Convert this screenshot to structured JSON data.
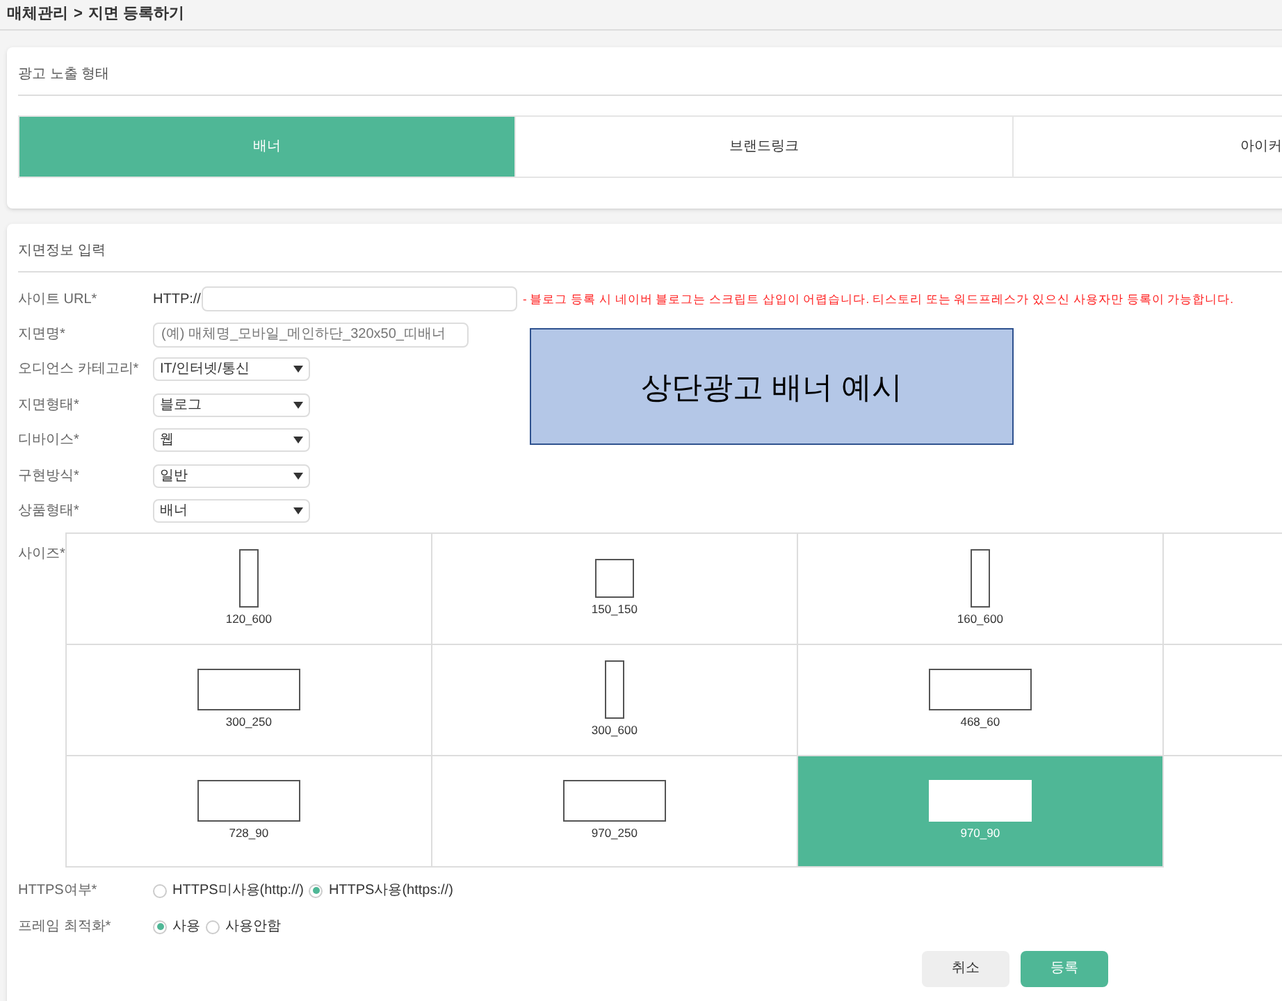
{
  "breadcrumb": {
    "parent": "매체관리",
    "separator": ">",
    "current": "지면 등록하기"
  },
  "ad_type": {
    "title": "광고 노출 형태",
    "tabs": [
      {
        "label": "배너",
        "selected": true
      },
      {
        "label": "브랜드링크",
        "selected": false
      },
      {
        "label": "아이커",
        "selected": false
      }
    ]
  },
  "form": {
    "title": "지면정보 입력",
    "site_url": {
      "label": "사이트 URL*",
      "prefix": "HTTP://",
      "notice": "- 블로그 등록 시 네이버 블로그는 스크립트 삽입이 어렵습니다. 티스토리 또는 워드프레스가 있으신 사용자만 등록이 가능합니다."
    },
    "slot_name": {
      "label": "지면명*",
      "placeholder": "(예) 매체명_모바일_메인하단_320x50_띠배너"
    },
    "selects": [
      {
        "label": "오디언스 카테고리*",
        "value": "IT/인터넷/통신"
      },
      {
        "label": "지면형태*",
        "value": "블로그"
      },
      {
        "label": "디바이스*",
        "value": "웹"
      },
      {
        "label": "구현방식*",
        "value": "일반"
      },
      {
        "label": "상품형태*",
        "value": "배너"
      }
    ],
    "size": {
      "label": "사이즈*",
      "options": [
        {
          "label": "120_600",
          "kind": "tall",
          "selected": false
        },
        {
          "label": "150_150",
          "kind": "square",
          "selected": false
        },
        {
          "label": "160_600",
          "kind": "tall",
          "selected": false
        },
        {
          "kind": "empty",
          "selected": false
        },
        {
          "label": "300_250",
          "kind": "wide",
          "selected": false
        },
        {
          "label": "300_600",
          "kind": "tall",
          "selected": false
        },
        {
          "label": "468_60",
          "kind": "wide",
          "selected": false
        },
        {
          "kind": "empty",
          "selected": false
        },
        {
          "label": "728_90",
          "kind": "wide",
          "selected": false
        },
        {
          "label": "970_250",
          "kind": "wide",
          "selected": false
        },
        {
          "label": "970_90",
          "kind": "wide",
          "selected": true
        }
      ]
    },
    "https": {
      "label": "HTTPS여부*",
      "options": [
        {
          "label": "HTTPS미사용(http://)",
          "selected": false
        },
        {
          "label": "HTTPS사용(https://)",
          "selected": true
        }
      ]
    },
    "frame": {
      "label": "프레임 최적화*",
      "options": [
        {
          "label": "사용",
          "selected": true
        },
        {
          "label": "사용안함",
          "selected": false
        }
      ]
    },
    "buttons": [
      {
        "label": "취소",
        "kind": "secondary"
      },
      {
        "label": "등록",
        "kind": "primary"
      }
    ]
  },
  "overlay": {
    "text": "상단광고 배너 예시"
  }
}
